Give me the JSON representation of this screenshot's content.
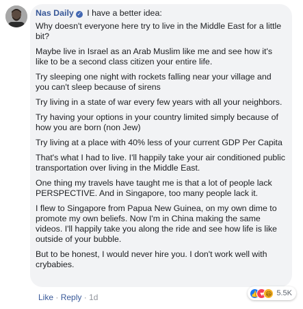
{
  "comment": {
    "author": "Nas Daily",
    "verified_symbol": "✓",
    "paragraphs": [
      "I have a better idea:",
      "Why doesn't everyone here try to live in the Middle East for a little bit?",
      "Maybe live in Israel as an Arab Muslim like me and see how it's like to be a second class citizen your entire life.",
      "Try sleeping one night with rockets falling near your village and you can't sleep because of sirens",
      "Try living in a state of war every few years with all your neighbors.",
      "Try having your options in your country limited simply because of how you are born (non Jew)",
      "Try living at a place with 40% less of your current GDP Per Capita",
      "That's what I had to live. I'll happily take your air conditioned public transportation over living in the Middle East.",
      "One thing my travels have taught me is that a lot of people lack PERSPECTIVE. And in Singapore, too many people lack it.",
      "I flew to Singapore from Papua New Guinea, on my own dime to promote my own beliefs. Now I'm in China making the same videos. I'll happily take you along the ride and see how life is like outside of your bubble.",
      "But to be honest, I would never hire you. I don't work well with crybabies."
    ]
  },
  "reactions": {
    "icons": [
      "like-icon",
      "love-icon",
      "haha-icon"
    ],
    "glyphs": [
      "👍",
      "♥",
      "😆"
    ],
    "count": "5.5K"
  },
  "actions": {
    "like": "Like",
    "separator": "·",
    "reply": "Reply",
    "time": "1d"
  },
  "colors": {
    "author": "#385898",
    "bubble": "#f2f3f5",
    "like": "#1877f2",
    "love": "#f33e58",
    "haha": "#f7b125"
  }
}
